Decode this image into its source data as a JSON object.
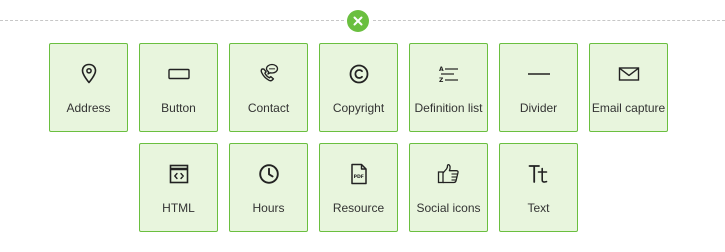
{
  "colors": {
    "accent": "#6abf3f",
    "tile_background": "#e8f5dd",
    "label": "#333333",
    "dashed_line": "#c7c7c7"
  },
  "close_button": {
    "icon": "close-icon"
  },
  "blocks": {
    "row1": [
      {
        "label": "Address",
        "icon": "map-pin-icon"
      },
      {
        "label": "Button",
        "icon": "button-icon"
      },
      {
        "label": "Contact",
        "icon": "phone-chat-icon"
      },
      {
        "label": "Copyright",
        "icon": "copyright-icon"
      },
      {
        "label": "Definition list",
        "icon": "definition-list-icon"
      },
      {
        "label": "Divider",
        "icon": "divider-line-icon"
      },
      {
        "label": "Email capture",
        "icon": "envelope-icon"
      }
    ],
    "row2": [
      {
        "label": "HTML",
        "icon": "code-window-icon"
      },
      {
        "label": "Hours",
        "icon": "clock-icon"
      },
      {
        "label": "Resource",
        "icon": "pdf-file-icon"
      },
      {
        "label": "Social icons",
        "icon": "thumbs-up-icon"
      },
      {
        "label": "Text",
        "icon": "text-type-icon"
      }
    ]
  }
}
